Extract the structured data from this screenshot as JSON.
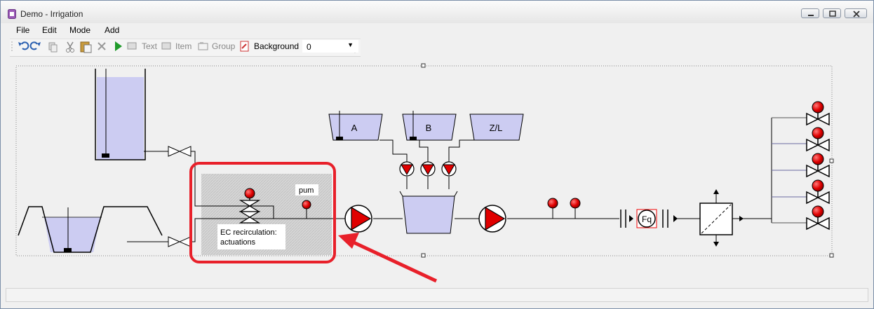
{
  "window": {
    "title": "Demo - Irrigation"
  },
  "menu": {
    "items": [
      "File",
      "Edit",
      "Mode",
      "Add"
    ]
  },
  "toolbar": {
    "text_label": "Text",
    "item_label": "Item",
    "group_label": "Group",
    "background_label": "Background",
    "background_value": "0"
  },
  "diagram": {
    "tanks": [
      "A",
      "B",
      "Z/L"
    ],
    "meter_label": "Fq",
    "valve_label": "pum",
    "group_label_line1": "EC recirculation:",
    "group_label_line2": "actuations"
  },
  "colors": {
    "tank_fill": "#ccccf2",
    "pump_red": "#e00000",
    "highlight_red": "#e8202a",
    "arrow_red": "#e8202a"
  }
}
